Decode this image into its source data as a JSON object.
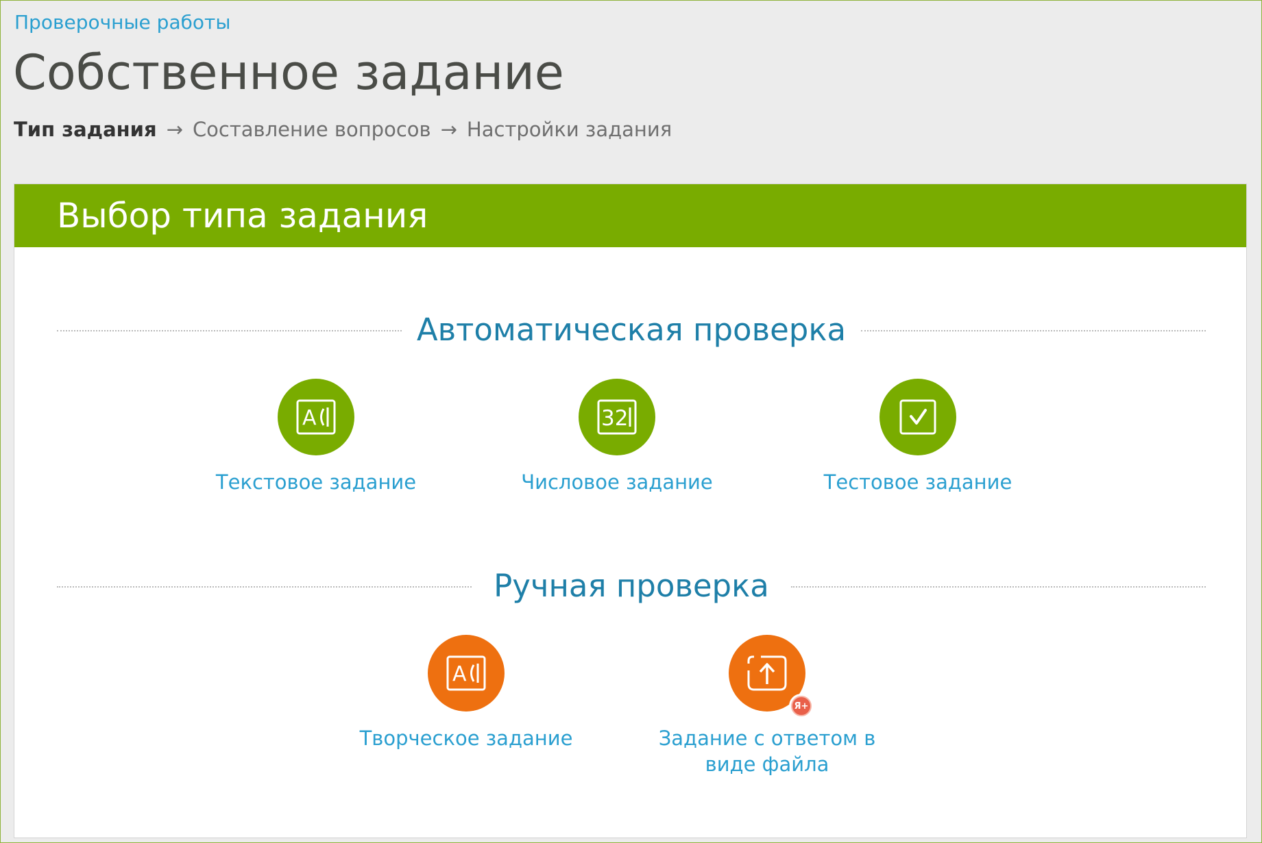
{
  "header": {
    "back_link": "Проверочные работы",
    "title": "Собственное задание"
  },
  "steps": [
    {
      "label": "Тип задания",
      "active": true
    },
    {
      "label": "Составление вопросов",
      "active": false
    },
    {
      "label": "Настройки задания",
      "active": false
    }
  ],
  "step_arrow": "→",
  "panel": {
    "title": "Выбор типа задания",
    "header_color": "#79ac00"
  },
  "sections": {
    "automatic": {
      "title": "Автоматическая проверка",
      "items": [
        {
          "label": "Текстовое задание",
          "icon": "text-input-icon"
        },
        {
          "label": "Числовое задание",
          "icon": "number-input-icon"
        },
        {
          "label": "Тестовое задание",
          "icon": "checkbox-icon"
        }
      ]
    },
    "manual": {
      "title": "Ручная проверка",
      "items": [
        {
          "label": "Творческое задание",
          "icon": "text-input-icon"
        },
        {
          "label": "Задание с ответом в виде файла",
          "icon": "upload-icon",
          "badge": "Я+"
        }
      ]
    }
  },
  "colors": {
    "green": "#79ac00",
    "orange": "#ee7010",
    "link": "#2a9fd0",
    "section_title": "#1e7fa8"
  }
}
